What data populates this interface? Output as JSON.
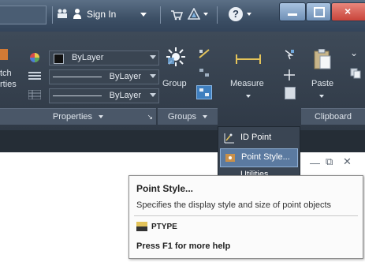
{
  "titlebar": {
    "sign_in": "Sign In",
    "help_symbol": "?"
  },
  "ribbon": {
    "properties": {
      "color_value": "ByLayer",
      "linetype_value": "ByLayer",
      "lineweight_value": "ByLayer",
      "match_properties_partial": "tch\nrties",
      "panel_title": "Properties"
    },
    "groups": {
      "group_label": "Group",
      "panel_title": "Groups"
    },
    "utilities": {
      "measure_label": "Measure"
    },
    "clipboard": {
      "paste_label": "Paste",
      "panel_title": "Clipboard"
    }
  },
  "dropdown": {
    "items": [
      {
        "label": "ID Point"
      },
      {
        "label": "Point Style..."
      },
      {
        "label": "Utilities"
      }
    ]
  },
  "tooltip": {
    "title": "Point Style...",
    "description": "Specifies the display style and size of point objects",
    "command": "PTYPE",
    "help": "Press F1 for more help"
  },
  "colors": {
    "titlebar": "#3c4f65",
    "ribbon": "#2f3946",
    "close_button": "#c9443a",
    "tooltip_bg": "#fbfbfb"
  }
}
